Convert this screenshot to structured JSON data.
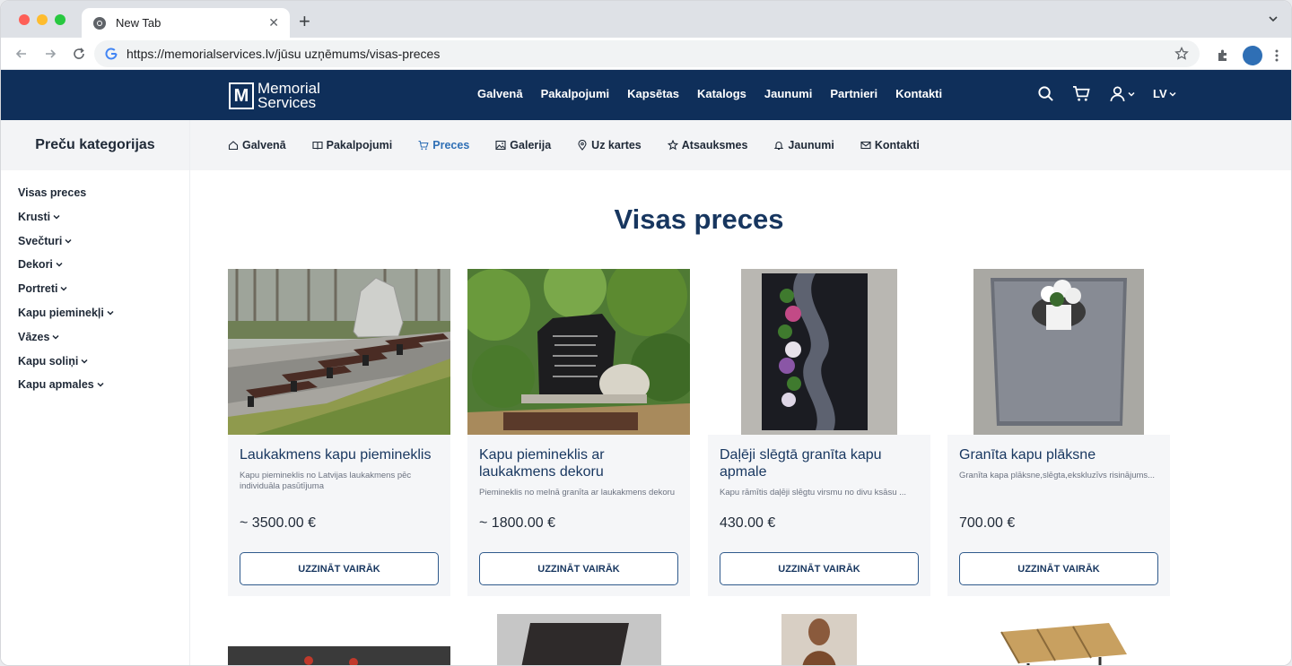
{
  "browser": {
    "tab_title": "New Tab",
    "new_tab": "+",
    "close": "✕",
    "url": "https://memorialservices.lv/jūsu uzņēmums/visas-preces"
  },
  "header": {
    "logo_line1": "Memorial",
    "logo_line2": "Services",
    "logo_mark": "M",
    "nav": [
      "Galvenā",
      "Pakalpojumi",
      "Kapsētas",
      "Katalogs",
      "Jaunumi",
      "Partnieri",
      "Kontakti"
    ],
    "lang": "LV"
  },
  "sidebar": {
    "title": "Preču kategorijas",
    "items": [
      {
        "label": "Visas preces",
        "has_children": false
      },
      {
        "label": "Krusti",
        "has_children": true
      },
      {
        "label": "Svečturi",
        "has_children": true
      },
      {
        "label": "Dekori",
        "has_children": true
      },
      {
        "label": "Portreti",
        "has_children": true
      },
      {
        "label": "Kapu pieminekļi",
        "has_children": true
      },
      {
        "label": "Vāzes",
        "has_children": true
      },
      {
        "label": "Kapu soliņi",
        "has_children": true
      },
      {
        "label": "Kapu apmales",
        "has_children": true
      }
    ]
  },
  "subnav": [
    {
      "label": "Galvenā",
      "icon": "home-icon"
    },
    {
      "label": "Pakalpojumi",
      "icon": "book-icon"
    },
    {
      "label": "Preces",
      "icon": "cart-icon",
      "active": true
    },
    {
      "label": "Galerija",
      "icon": "image-icon"
    },
    {
      "label": "Uz kartes",
      "icon": "map-pin-icon"
    },
    {
      "label": "Atsauksmes",
      "icon": "star-icon"
    },
    {
      "label": "Jaunumi",
      "icon": "bell-icon"
    },
    {
      "label": "Kontakti",
      "icon": "mail-icon"
    }
  ],
  "main": {
    "title": "Visas preces",
    "button_label": "UZZINĀT VAIRĀK",
    "products": [
      {
        "name": "Laukakmens kapu piemineklis",
        "desc": "Kapu piemineklis no Latvijas laukakmens pēc individuāla pasūtījuma",
        "price": "~ 3500.00 €"
      },
      {
        "name": "Kapu piemineklis ar laukakmens dekoru",
        "desc": "Piemineklis no melnā granīta ar laukakmens dekoru",
        "price": "~ 1800.00 €"
      },
      {
        "name": "Daļēji slēgtā granīta kapu apmale",
        "desc": "Kapu rāmītis daļēji slēgtu virsmu no divu ksāsu ...",
        "price": "430.00 €"
      },
      {
        "name": "Granīta kapu plāksne",
        "desc": "Granīta kapa plāksne,slēgta,ekskluzīvs risinājums...",
        "price": "700.00 €"
      }
    ]
  }
}
